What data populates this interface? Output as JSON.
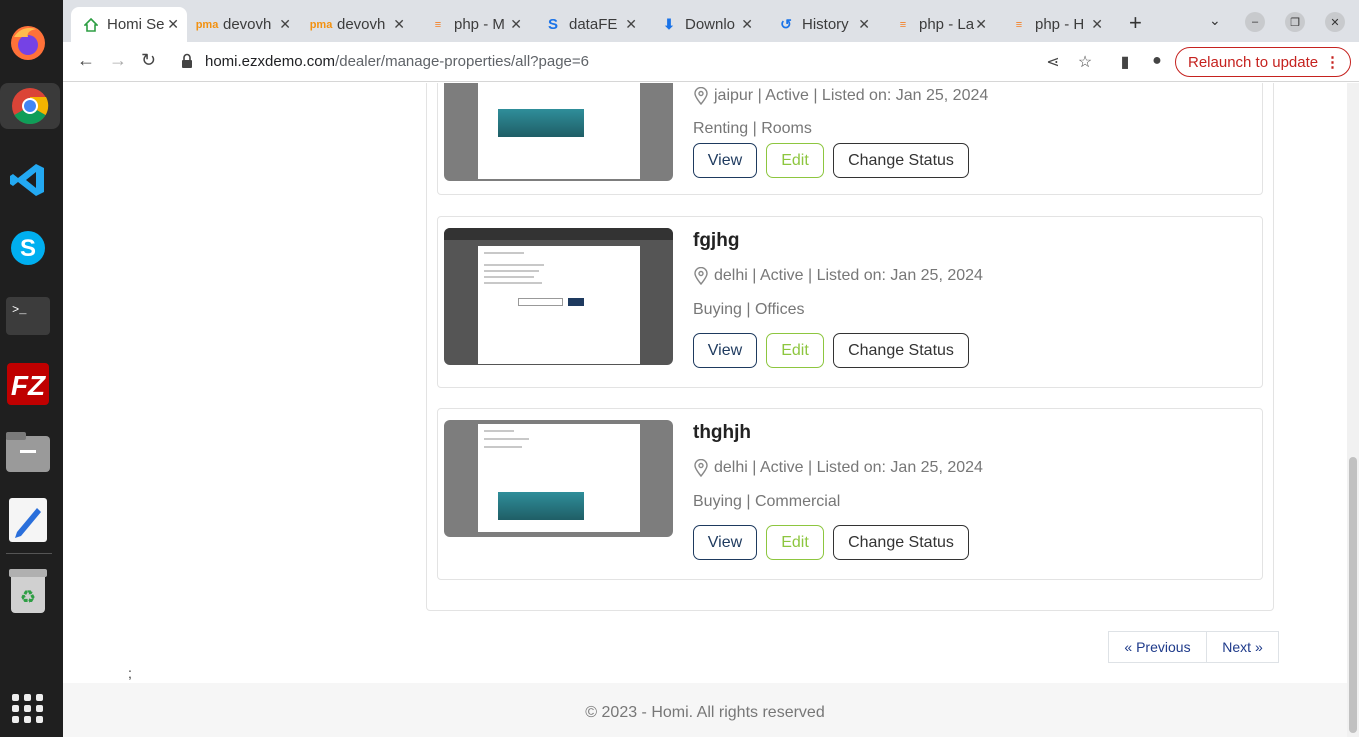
{
  "browser": {
    "tabs": [
      {
        "title": "Homi Se",
        "icon": "home-icon",
        "color": "#2e9e44"
      },
      {
        "title": "devovh",
        "icon": "pma-icon",
        "color": "#f29111"
      },
      {
        "title": "devovh",
        "icon": "pma-icon",
        "color": "#f29111"
      },
      {
        "title": "php - M",
        "icon": "stackoverflow-icon",
        "color": "#f48024"
      },
      {
        "title": "dataFE",
        "icon": "s-icon",
        "color": "#1a73e8"
      },
      {
        "title": "Downlo",
        "icon": "download-icon",
        "color": "#1a73e8"
      },
      {
        "title": "History",
        "icon": "history-icon",
        "color": "#1a73e8"
      },
      {
        "title": "php - La",
        "icon": "stackoverflow-icon",
        "color": "#f48024"
      },
      {
        "title": "php - H",
        "icon": "stackoverflow-icon",
        "color": "#f48024"
      }
    ],
    "new_tab": "+",
    "url_host": "homi.ezxdemo.com",
    "url_path": "/dealer/manage-properties/all?page=6",
    "relaunch_label": "Relaunch to update"
  },
  "properties": [
    {
      "title": "",
      "location": "jaipur",
      "status": "Active",
      "listed": "Listed on: Jan 25, 2024",
      "meta": "jaipur | Active | Listed on: Jan 25, 2024",
      "type": "Renting | Rooms",
      "view_label": "View",
      "edit_label": "Edit",
      "status_label": "Change Status"
    },
    {
      "title": "fgjhg",
      "meta": "delhi | Active | Listed on: Jan 25, 2024",
      "type": "Buying | Offices",
      "view_label": "View",
      "edit_label": "Edit",
      "status_label": "Change Status"
    },
    {
      "title": "thghjh",
      "meta": "delhi | Active | Listed on: Jan 25, 2024",
      "type": "Buying | Commercial",
      "view_label": "View",
      "edit_label": "Edit",
      "status_label": "Change Status"
    }
  ],
  "pagination": {
    "previous": "« Previous",
    "next": "Next »"
  },
  "stray_text": ";",
  "footer": {
    "text": "© 2023 - Homi. All rights reserved"
  },
  "colors": {
    "primary": "#1e3a5f",
    "edit": "#8dc63f",
    "relaunch": "#c5221f"
  }
}
